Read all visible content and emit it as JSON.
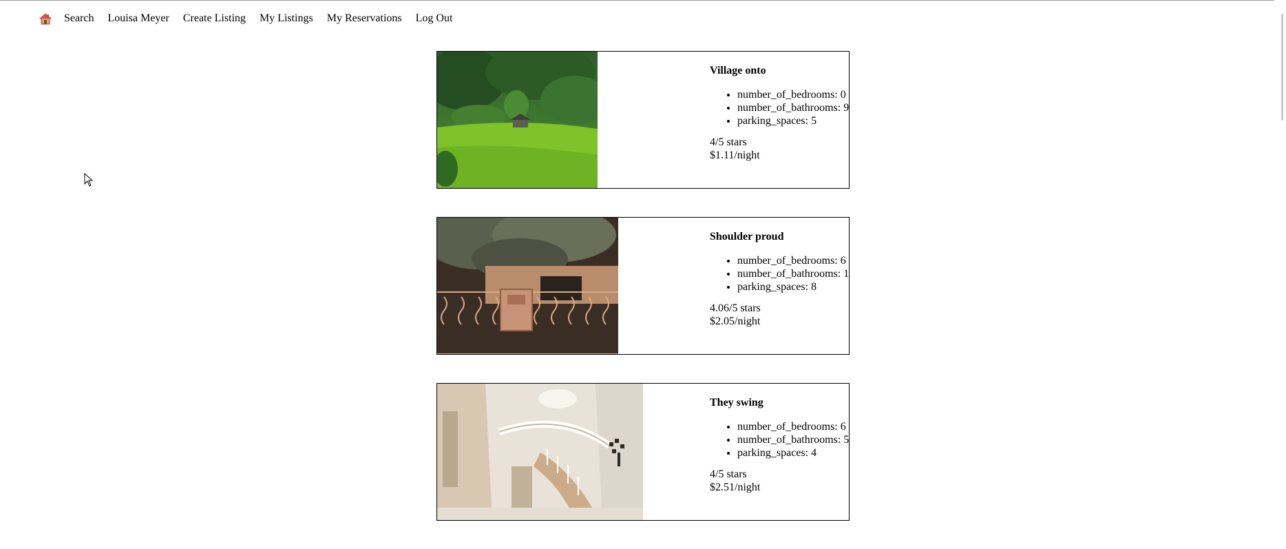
{
  "nav": {
    "home_icon": "house-icon",
    "items": [
      {
        "label": "Search"
      },
      {
        "label": "Louisa Meyer"
      },
      {
        "label": "Create Listing"
      },
      {
        "label": "My Listings"
      },
      {
        "label": "My Reservations"
      },
      {
        "label": "Log Out"
      }
    ]
  },
  "listings": [
    {
      "title": "Village onto",
      "photo": "green hillside with small cabin",
      "features": [
        "number_of_bedrooms: 0",
        "number_of_bathrooms: 9",
        "parking_spaces: 5"
      ],
      "rating": "4/5 stars",
      "price": "$1.11/night"
    },
    {
      "title": "Shoulder proud",
      "photo": "ornate iron gate with mailbox under tree",
      "features": [
        "number_of_bedrooms: 6",
        "number_of_bathrooms: 1",
        "parking_spaces: 8"
      ],
      "rating": "4.06/5 stars",
      "price": "$2.05/night"
    },
    {
      "title": "They swing",
      "photo": "bright foyer with curved staircase",
      "features": [
        "number_of_bedrooms: 6",
        "number_of_bathrooms: 5",
        "parking_spaces: 4"
      ],
      "rating": "4/5 stars",
      "price": "$2.51/night"
    }
  ]
}
